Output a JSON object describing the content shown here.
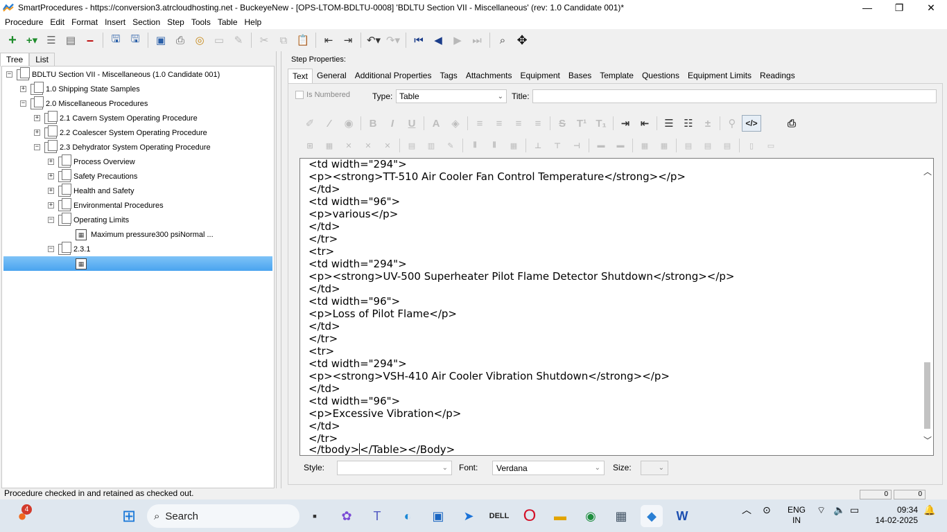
{
  "window": {
    "title": "SmartProcedures - https://conversion3.atrcloudhosting.net - BuckeyeNew - [OPS-LTOM-BDLTU-0008] 'BDLTU Section VII - Miscellaneous' (rev: 1.0 Candidate 001)*",
    "minimize": "—",
    "maximize": "❐",
    "close": "✕"
  },
  "menu": [
    "Procedure",
    "Edit",
    "Format",
    "Insert",
    "Section",
    "Step",
    "Tools",
    "Table",
    "Help"
  ],
  "left_tabs": [
    "Tree",
    "List"
  ],
  "tree": {
    "root": "BDLTU Section VII - Miscellaneous (1.0 Candidate 001)",
    "n1": "1.0 Shipping State Samples",
    "n2": "2.0 Miscellaneous Procedures",
    "n21": "2.1 Cavern System Operating Procedure",
    "n22": "2.2 Coalescer System Operating Procedure",
    "n23": "2.3 Dehydrator System Operating Procedure",
    "process_overview": "Process Overview",
    "safety_precautions": "Safety Precautions",
    "health_safety": "Health and Safety",
    "environmental": "Environmental Procedures",
    "operating_limits": "Operating Limits",
    "max_pressure": "Maximum pressure300 psiNormal ...",
    "n231": "2.3.1"
  },
  "step_properties_label": "Step Properties:",
  "right_tabs": [
    "Text",
    "General",
    "Additional Properties",
    "Tags",
    "Attachments",
    "Equipment",
    "Bases",
    "Template",
    "Questions",
    "Equipment Limits",
    "Readings"
  ],
  "is_numbered_label": "Is Numbered",
  "type_label": "Type:",
  "type_value": "Table",
  "title_label": "Title:",
  "title_value": "",
  "editor_lines": [
    "<td width=\"294\">",
    "<p><strong>TT-510 Air Cooler Fan Control Temperature</strong></p>",
    "</td>",
    "<td width=\"96\">",
    "<p>various</p>",
    "</td>",
    "</tr>",
    "<tr>",
    "<td width=\"294\">",
    "<p><strong>UV-500 Superheater Pilot Flame Detector Shutdown</strong></p>",
    "</td>",
    "<td width=\"96\">",
    "<p>Loss of Pilot Flame</p>",
    "</td>",
    "</tr>",
    "<tr>",
    "<td width=\"294\">",
    "<p><strong>VSH-410 Air Cooler Vibration Shutdown</strong></p>",
    "</td>",
    "<td width=\"96\">",
    "<p>Excessive Vibration</p>",
    "</td>",
    "</tr>"
  ],
  "editor_last_before_caret": "</tbody>",
  "editor_last_after_caret": "</Table></Body>",
  "style_label": "Style:",
  "style_value": "",
  "font_label": "Font:",
  "font_value": "Verdana",
  "size_label": "Size:",
  "size_value": "",
  "status_text": "Procedure checked in and retained as checked out.",
  "status_cells": [
    "0",
    "0"
  ],
  "taskbar": {
    "search_placeholder": "Search",
    "notification_count": "4",
    "lang_line1": "ENG",
    "lang_line2": "IN",
    "time": "09:34",
    "date": "14-02-2025"
  }
}
